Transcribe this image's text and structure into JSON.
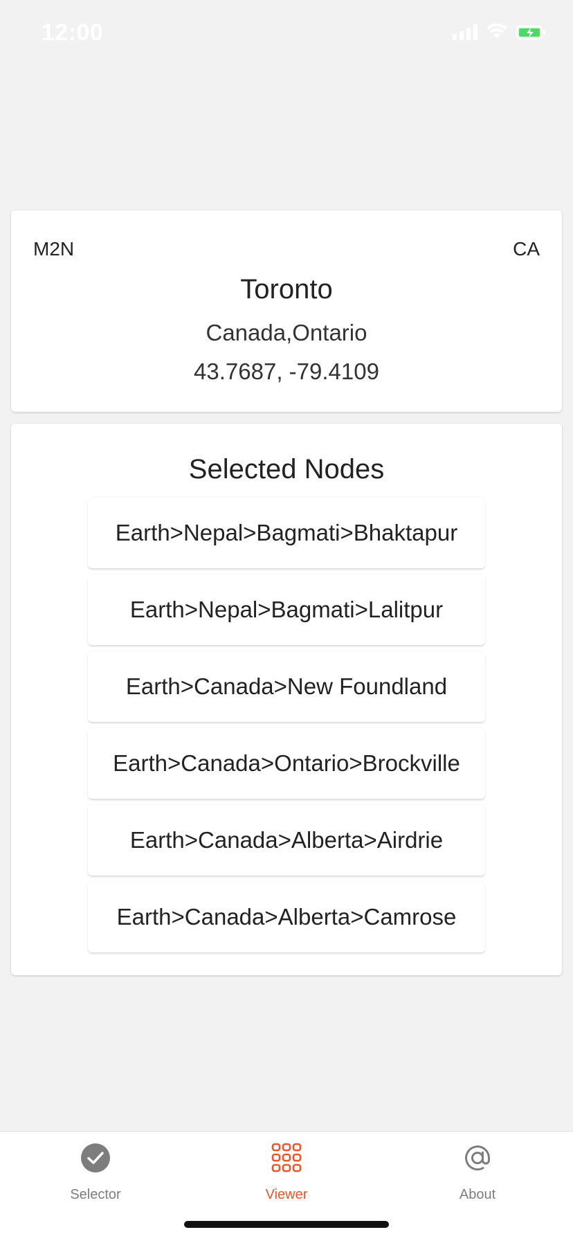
{
  "status_bar": {
    "time": "12:00"
  },
  "location": {
    "postal_code": "M2N",
    "country_code": "CA",
    "city": "Toronto",
    "region": "Canada,Ontario",
    "coordinates": "43.7687, -79.4109"
  },
  "selected_nodes": {
    "title": "Selected Nodes",
    "items": [
      "Earth>Nepal>Bagmati>Bhaktapur",
      "Earth>Nepal>Bagmati>Lalitpur",
      "Earth>Canada>New Foundland",
      "Earth>Canada>Ontario>Brockville",
      "Earth>Canada>Alberta>Airdrie",
      "Earth>Canada>Alberta>Camrose"
    ]
  },
  "tabs": [
    {
      "label": "Selector",
      "icon": "check-circle-icon"
    },
    {
      "label": "Viewer",
      "icon": "grid-icon"
    },
    {
      "label": "About",
      "icon": "at-icon"
    }
  ],
  "colors": {
    "accent": "#e4572e",
    "inactive": "#7d7d7d",
    "background": "#f2f2f2"
  }
}
